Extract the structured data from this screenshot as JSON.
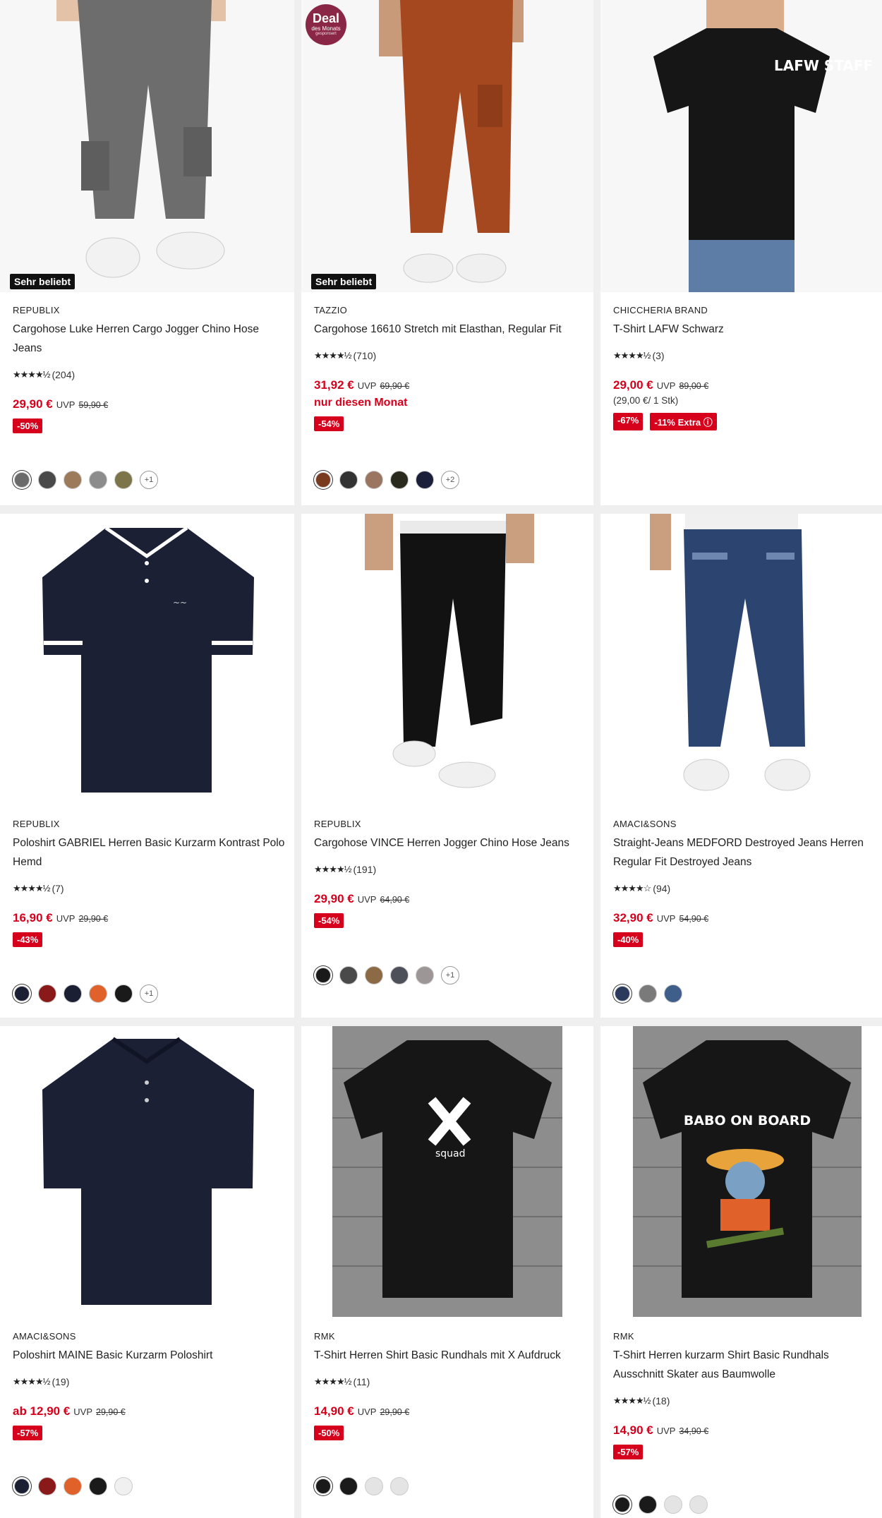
{
  "products": [
    {
      "brand": "REPUBLIX",
      "title": "Cargohose Luke Herren Cargo Jogger Chino Hose Jeans",
      "badge": "Sehr beliebt",
      "stars": "★★★★½",
      "rating_count": "(204)",
      "price": "29,90 €",
      "uvp_label": "UVP",
      "uvp": "59,90 €",
      "discount": "-50%",
      "image_icon": "cargo-pants-grey",
      "colors": [
        "#6a6a6a",
        "#4a4a4a",
        "#9c7a5a",
        "#8c8c8c",
        "#7d7549"
      ],
      "more_colors": "+1"
    },
    {
      "brand": "TAZZIO",
      "title": "Cargohose 16610 Stretch mit Elasthan, Regular Fit",
      "badge": "Sehr beliebt",
      "deal": {
        "title": "Deal",
        "subtitle": "des Monats",
        "note": "gesponsert"
      },
      "stars": "★★★★½",
      "rating_count": "(710)",
      "price": "31,92 €",
      "uvp_label": "UVP",
      "uvp": "69,90 €",
      "extra_text": "nur diesen Monat",
      "discount": "-54%",
      "image_icon": "cargo-pants-rust",
      "colors": [
        "#7a3a1e",
        "#333333",
        "#9a7560",
        "#2a2a1e",
        "#1b1f3a"
      ],
      "more_colors": "+2"
    },
    {
      "brand": "CHICCHERIA BRAND",
      "title": "T-Shirt LAFW Schwarz",
      "stars": "★★★★½",
      "rating_count": "(3)",
      "price": "29,00 €",
      "uvp_label": "UVP",
      "uvp": "89,00 €",
      "unit_price": "(29,00 €/ 1 Stk)",
      "discount": "-67%",
      "extra_discount": "-11% Extra ⓘ",
      "image_icon": "tshirt-lafw",
      "print_text": "LAFW STAFF"
    },
    {
      "brand": "REPUBLIX",
      "title": "Poloshirt GABRIEL Herren Basic Kurzarm Kontrast Polo Hemd",
      "stars": "★★★★½",
      "rating_count": "(7)",
      "price": "16,90 €",
      "uvp_label": "UVP",
      "uvp": "29,90 €",
      "discount": "-43%",
      "image_icon": "polo-navy-contrast",
      "colors": [
        "#1b1f33",
        "#8a1a1a",
        "#1b1f33",
        "#e0622a",
        "#1a1a1a"
      ],
      "more_colors": "+1"
    },
    {
      "brand": "REPUBLIX",
      "title": "Cargohose VINCE Herren Jogger Chino Hose Jeans",
      "stars": "★★★★½",
      "rating_count": "(191)",
      "price": "29,90 €",
      "uvp_label": "UVP",
      "uvp": "64,90 €",
      "discount": "-54%",
      "image_icon": "cargo-jogger-black",
      "colors": [
        "#1a1a1a",
        "#4a4a4a",
        "#8c6a45",
        "#4d5058",
        "#9c9696"
      ],
      "more_colors": "+1"
    },
    {
      "brand": "AMACI&SONS",
      "title": "Straight-Jeans MEDFORD Destroyed Jeans Herren Regular Fit Destroyed Jeans",
      "stars": "★★★★☆",
      "rating_count": "(94)",
      "price": "32,90 €",
      "uvp_label": "UVP",
      "uvp": "54,90 €",
      "discount": "-40%",
      "image_icon": "jeans-destroyed-blue",
      "colors": [
        "#2a3a5c",
        "#7a7a7a",
        "#3f5f8a"
      ]
    },
    {
      "brand": "AMACI&SONS",
      "title": "Poloshirt MAINE Basic Kurzarm Poloshirt",
      "stars": "★★★★½",
      "rating_count": "(19)",
      "price": "ab 12,90 €",
      "uvp_label": "UVP",
      "uvp": "29,90 €",
      "discount": "-57%",
      "image_icon": "polo-navy",
      "colors": [
        "#1b1f33",
        "#8a1a1a",
        "#e0622a",
        "#1a1a1a",
        "#f0f0f0"
      ]
    },
    {
      "brand": "RMK",
      "title": "T-Shirt Herren Shirt Basic Rundhals mit X Aufdruck",
      "stars": "★★★★½",
      "rating_count": "(11)",
      "price": "14,90 €",
      "uvp_label": "UVP",
      "uvp": "29,90 €",
      "discount": "-50%",
      "image_icon": "tshirt-x-squad",
      "print_text": "squad",
      "colors": [
        "#1a1a1a",
        "#1a1a1a",
        "#e4e4e4",
        "#e4e4e4"
      ]
    },
    {
      "brand": "RMK",
      "title": "T-Shirt Herren kurzarm Shirt Basic Rundhals Ausschnitt Skater aus Baumwolle",
      "stars": "★★★★½",
      "rating_count": "(18)",
      "price": "14,90 €",
      "uvp_label": "UVP",
      "uvp": "34,90 €",
      "discount": "-57%",
      "image_icon": "tshirt-babo-on-board",
      "print_text": "BABO ON BOARD",
      "colors": [
        "#1a1a1a",
        "#1a1a1a",
        "#e4e4e4",
        "#e4e4e4"
      ]
    }
  ]
}
